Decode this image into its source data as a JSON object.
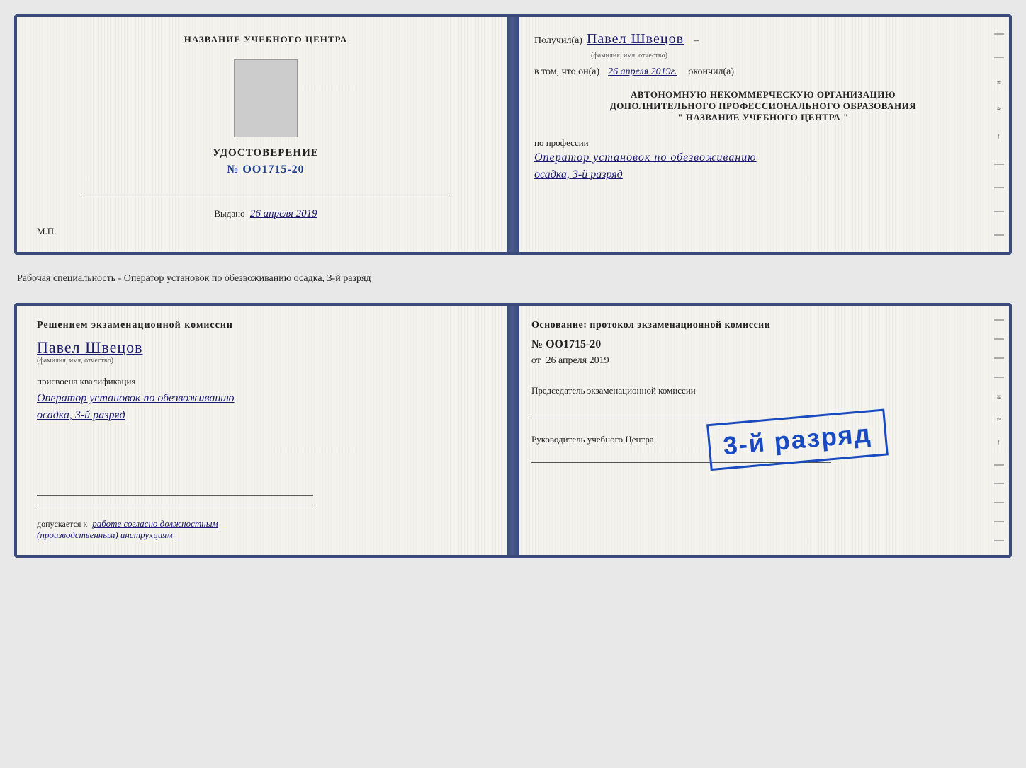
{
  "page": {
    "background_color": "#e8e8e8"
  },
  "top_card": {
    "left": {
      "center_title": "НАЗВАНИЕ УЧЕБНОГО ЦЕНТРА",
      "cert_title": "УДОСТОВЕРЕНИЕ",
      "cert_number": "№ OO1715-20",
      "issued_label": "Выдано",
      "issued_date": "26 апреля 2019",
      "mp_label": "М.П."
    },
    "right": {
      "received_prefix": "Получил(а)",
      "recipient_name": "Павел Швецов",
      "fio_label": "(фамилия, имя, отчество)",
      "dash": "–",
      "in_that_prefix": "в том, что он(а)",
      "date_value": "26 апреля 2019г.",
      "finished_label": "окончил(а)",
      "institution_line1": "АВТОНОМНУЮ НЕКОММЕРЧЕСКУЮ ОРГАНИЗАЦИЮ",
      "institution_line2": "ДОПОЛНИТЕЛЬНОГО ПРОФЕССИОНАЛЬНОГО ОБРАЗОВАНИЯ",
      "institution_line3": "\"   НАЗВАНИЕ УЧЕБНОГО ЦЕНТРА   \"",
      "profession_prefix": "по профессии",
      "profession_value1": "Оператор установок по обезвоживанию",
      "profession_value2": "осадка, 3-й разряд"
    }
  },
  "separator": {
    "text": "Рабочая специальность - Оператор установок по обезвоживанию осадка, 3-й разряд"
  },
  "bottom_card": {
    "left": {
      "decision_title": "Решением экзаменационной комиссии",
      "person_name": "Павел Швецов",
      "fio_label": "(фамилия, имя, отчество)",
      "assigned_label": "присвоена квалификация",
      "qualification_line1": "Оператор установок по обезвоживанию",
      "qualification_line2": "осадка, 3-й разряд",
      "allowed_prefix": "допускается к",
      "allowed_value": "работе согласно должностным",
      "allowed_value2": "(производственным) инструкциям"
    },
    "right": {
      "basis_label": "Основание: протокол экзаменационной комиссии",
      "protocol_number": "№ OO1715-20",
      "date_prefix": "от",
      "date_value": "26 апреля 2019",
      "chairman_label": "Председатель экзаменационной комиссии",
      "director_label": "Руководитель учебного Центра"
    },
    "stamp": {
      "text": "3-й разряд"
    }
  }
}
